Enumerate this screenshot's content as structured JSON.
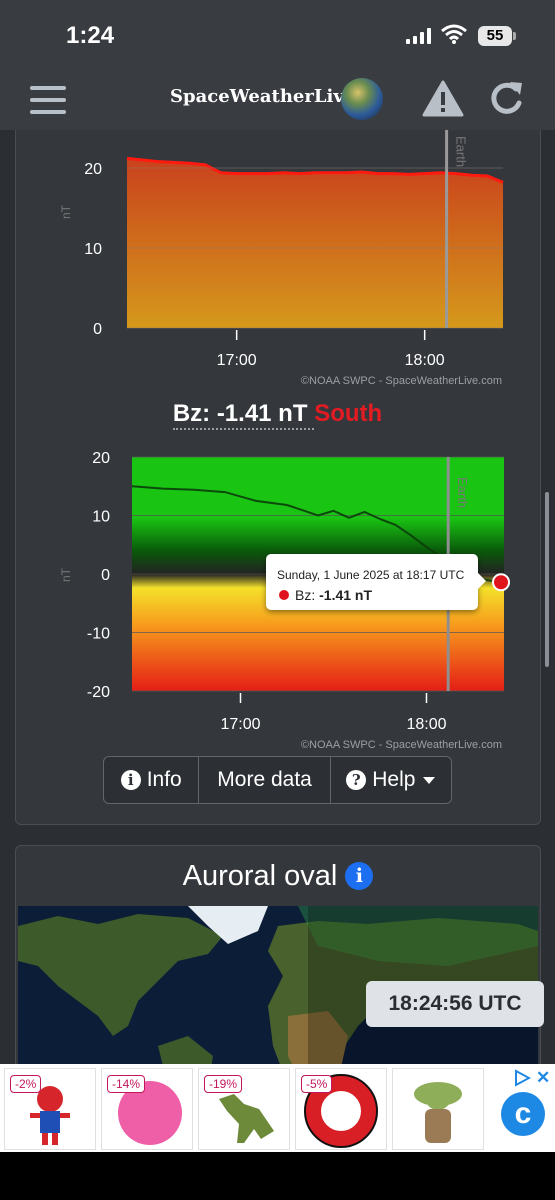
{
  "status_bar": {
    "time": "1:24",
    "battery": "55"
  },
  "header": {
    "brand": "SpaceWeatherLive"
  },
  "bt_chart": {
    "chart_data": {
      "type": "area",
      "ylabel": "nT",
      "yticks": [
        "20",
        "10",
        "0"
      ],
      "ylim": [
        0,
        22
      ],
      "xticks": [
        "17:00",
        "18:00"
      ],
      "marker_label": "Earth",
      "credit": "©NOAA SWPC - SpaceWeatherLive.com",
      "x_minutes": [
        0,
        5,
        10,
        15,
        20,
        25,
        30,
        35,
        40,
        45,
        50,
        55,
        60,
        65,
        70,
        75,
        80,
        85,
        90,
        95,
        100,
        105,
        110,
        115,
        120
      ],
      "values": [
        21.2,
        21.0,
        20.8,
        20.7,
        20.6,
        20.4,
        19.4,
        19.3,
        19.3,
        19.3,
        19.4,
        19.3,
        19.4,
        19.4,
        19.4,
        19.5,
        19.3,
        19.3,
        19.2,
        19.3,
        19.4,
        19.3,
        19.1,
        19.0,
        18.2
      ]
    }
  },
  "bz": {
    "label": "Bz:",
    "value": "-1.41 nT",
    "direction": "South"
  },
  "bz_chart": {
    "chart_data": {
      "type": "line",
      "ylabel": "nT",
      "yticks": [
        "20",
        "10",
        "0",
        "-10",
        "-20"
      ],
      "ylim": [
        -20,
        20
      ],
      "xticks": [
        "17:00",
        "18:00"
      ],
      "marker_label": "Earth",
      "credit": "©NOAA SWPC - SpaceWeatherLive.com",
      "x_minutes": [
        0,
        10,
        20,
        30,
        40,
        50,
        55,
        60,
        65,
        70,
        75,
        80,
        85,
        90,
        95,
        100,
        105,
        110,
        115,
        120
      ],
      "values": [
        15.0,
        14.6,
        14.4,
        14.0,
        12.5,
        11.8,
        10.9,
        10.0,
        10.8,
        9.6,
        10.6,
        9.4,
        8.4,
        6.6,
        4.6,
        2.8,
        0.6,
        -0.6,
        -1.1,
        -1.41
      ]
    }
  },
  "tooltip": {
    "date": "Sunday, 1 June 2025 at 18:17 UTC",
    "series": "Bz:",
    "value": "-1.41 nT"
  },
  "buttons": {
    "info": "Info",
    "more_data": "More data",
    "help": "Help"
  },
  "aurora": {
    "title": "Auroral oval",
    "utc_time": "18:24:56 UTC"
  },
  "ads": {
    "discounts": [
      "-2%",
      "-14%",
      "-19%",
      "-5%"
    ]
  }
}
